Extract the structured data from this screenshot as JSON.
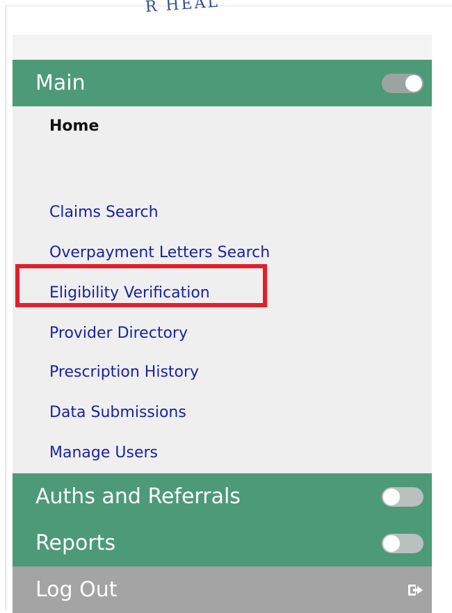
{
  "logo": {
    "text": "R HEAL"
  },
  "sidebar": {
    "main": {
      "label": "Main",
      "toggle_state": "on",
      "items": [
        {
          "label": "Home",
          "active": true
        },
        {
          "label": "Claims Search"
        },
        {
          "label": "Overpayment Letters Search"
        },
        {
          "label": "Eligibility Verification",
          "highlighted": true
        },
        {
          "label": "Provider Directory"
        },
        {
          "label": "Prescription History"
        },
        {
          "label": "Data Submissions"
        },
        {
          "label": "Manage Users"
        }
      ]
    },
    "auths": {
      "label": "Auths and Referrals",
      "toggle_state": "off"
    },
    "reports": {
      "label": "Reports",
      "toggle_state": "off"
    },
    "logout": {
      "label": "Log Out",
      "icon": "logout-icon"
    }
  },
  "colors": {
    "header_green": "#4c9a78",
    "submenu_bg": "#efefef",
    "link_blue": "#1a22a0",
    "highlight_red": "#e2202a",
    "logout_gray": "#a4a4a4"
  }
}
